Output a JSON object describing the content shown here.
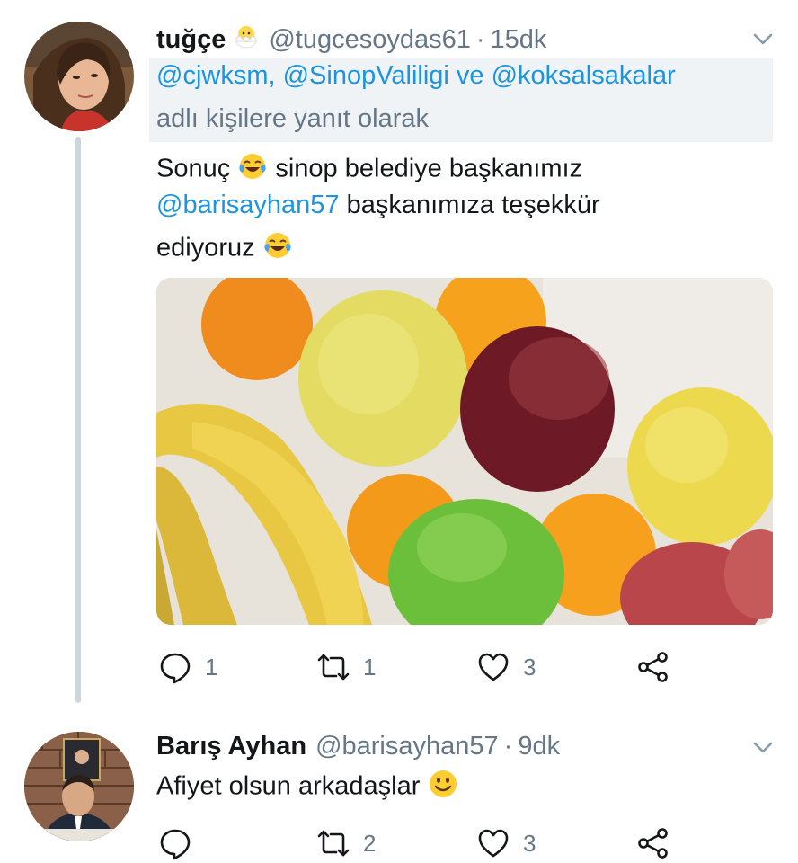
{
  "tweets": [
    {
      "name": "tuğçe",
      "emoji": "chick-emoji",
      "handle": "@tugcesoydas61",
      "separator": "·",
      "time": "15dk",
      "reply_to_mentions": "@cjwksm, @SinopValiligi ve @koksalsakalar",
      "reply_to_suffix": "adlı kişilere yanıt olarak",
      "text_line1": "Sonuç",
      "text_line1_rest": "sinop belediye başkanımız",
      "text_line2_mention": "@barisayhan57",
      "text_line2_rest": "başkanımıza teşekkür",
      "text_line3": "ediyoruz",
      "media_description_icon": "fruit-photo",
      "actions": {
        "replies": "1",
        "retweets": "1",
        "likes": "3"
      }
    },
    {
      "name": "Barış Ayhan",
      "handle": "@barisayhan57",
      "separator": "·",
      "time": "9dk",
      "text": "Afiyet olsun arkadaşlar",
      "actions": {
        "replies": "",
        "retweets": "2",
        "likes": "3"
      }
    }
  ],
  "colors": {
    "link": "#1b95e0",
    "secondary": "#657786",
    "thread_line": "#ccd6dd",
    "reply_box": "#f0f3f5"
  }
}
